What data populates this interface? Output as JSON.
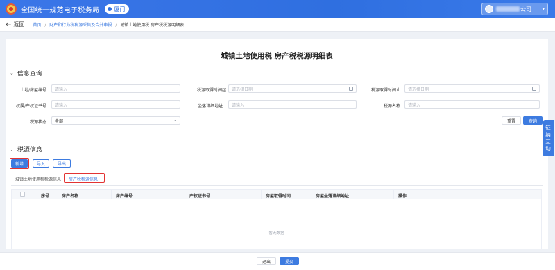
{
  "header": {
    "app_title": "全国统一规范电子税务局",
    "city": "厦门",
    "user_suffix": "公司",
    "caret": "▾"
  },
  "breadcrumb": {
    "back_label": "返回",
    "back_icon": "←",
    "items": [
      "首页",
      "财产和行为税税源采集及合并申报",
      "城镇土地使用税 房产税税源明细表"
    ],
    "separator": "/"
  },
  "page": {
    "title": "城镇土地使用税 房产税税源明细表"
  },
  "query": {
    "section_title": "信息查询",
    "chevron": "⌄",
    "fields": {
      "land_no": {
        "label": "土地/房屋编号",
        "placeholder": "请输入"
      },
      "acquire_start": {
        "label": "税源取得时间起",
        "placeholder": "请选择日期"
      },
      "acquire_end": {
        "label": "税源取得时间止",
        "placeholder": "请选择日期"
      },
      "cert_no": {
        "label": "权属/产权证书号",
        "placeholder": "请输入"
      },
      "address": {
        "label": "坐落详细地址",
        "placeholder": "请输入"
      },
      "source_name": {
        "label": "税源名称",
        "placeholder": "请输入"
      },
      "status": {
        "label": "税源状态",
        "value": "全部"
      }
    },
    "reset_label": "重置",
    "search_label": "查询"
  },
  "sources": {
    "section_title": "税源信息",
    "add_label": "新增",
    "import_label": "导入",
    "export_label": "导出",
    "tabs": [
      "城镇土地使用税税源信息",
      "房产税税源信息"
    ],
    "active_tab": 1,
    "columns": [
      "序号",
      "房产名称",
      "房产编号",
      "产权证书号",
      "房屋取得时间",
      "房屋坐落详细地址",
      "操作"
    ],
    "empty_text": "暂无数据"
  },
  "side_float": {
    "label": "征纳互动"
  },
  "footer": {
    "exit_label": "退出",
    "submit_label": "提交"
  },
  "colors": {
    "primary": "#3d7be0",
    "header": "#2f6fe0",
    "highlight": "#e23333"
  }
}
